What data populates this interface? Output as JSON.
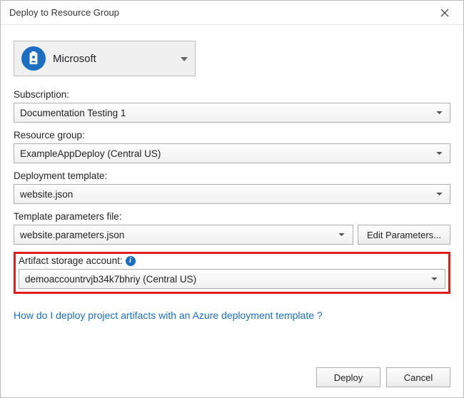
{
  "window": {
    "title": "Deploy to Resource Group"
  },
  "account": {
    "name": "Microsoft"
  },
  "fields": {
    "subscription": {
      "label": "Subscription:",
      "value": "Documentation Testing 1"
    },
    "resource_group": {
      "label": "Resource group:",
      "value": "ExampleAppDeploy (Central US)"
    },
    "deployment_template": {
      "label": "Deployment template:",
      "value": "website.json"
    },
    "template_params": {
      "label": "Template parameters file:",
      "value": "website.parameters.json",
      "edit_button": "Edit Parameters..."
    },
    "artifact_storage": {
      "label": "Artifact storage account:",
      "value": "demoaccountrvjb34k7bhriy (Central US)"
    }
  },
  "help_link": "How do I deploy project artifacts with an Azure deployment template ?",
  "buttons": {
    "deploy": "Deploy",
    "cancel": "Cancel"
  }
}
